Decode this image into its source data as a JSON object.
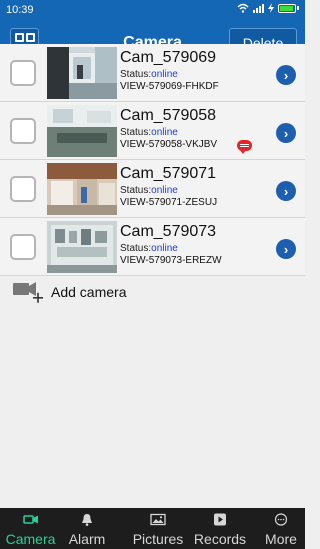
{
  "status_bar": {
    "time": "10:39"
  },
  "header": {
    "title": "Camera",
    "delete_label": "Delete"
  },
  "cameras": [
    {
      "name": "Cam_579069",
      "status_label": "Status:",
      "status_value": "online",
      "view_id": "VIEW-579069-FHKDF",
      "has_message": false
    },
    {
      "name": "Cam_579058",
      "status_label": "Status:",
      "status_value": "online",
      "view_id": "VIEW-579058-VKJBV",
      "has_message": true
    },
    {
      "name": "Cam_579071",
      "status_label": "Status:",
      "status_value": "online",
      "view_id": "VIEW-579071-ZESUJ",
      "has_message": false
    },
    {
      "name": "Cam_579073",
      "status_label": "Status:",
      "status_value": "online",
      "view_id": "VIEW-579073-EREZW",
      "has_message": false
    }
  ],
  "add_camera": {
    "label": "Add camera",
    "icon": "video-camera-plus-icon"
  },
  "tabs": [
    {
      "label": "Camera",
      "icon": "video-camera-icon",
      "active": true
    },
    {
      "label": "Alarm",
      "icon": "bell-icon",
      "active": false
    },
    {
      "label": "Pictures",
      "icon": "picture-icon",
      "active": false
    },
    {
      "label": "Records",
      "icon": "play-record-icon",
      "active": false
    },
    {
      "label": "More",
      "icon": "more-dots-icon",
      "active": false
    }
  ],
  "colors": {
    "header_blue": "#1467b4",
    "online_blue": "#1a3fd6",
    "active_tab_green": "#27d19b",
    "tab_bar_bg": "#1d1d1d",
    "message_badge_red": "#e2262a"
  }
}
